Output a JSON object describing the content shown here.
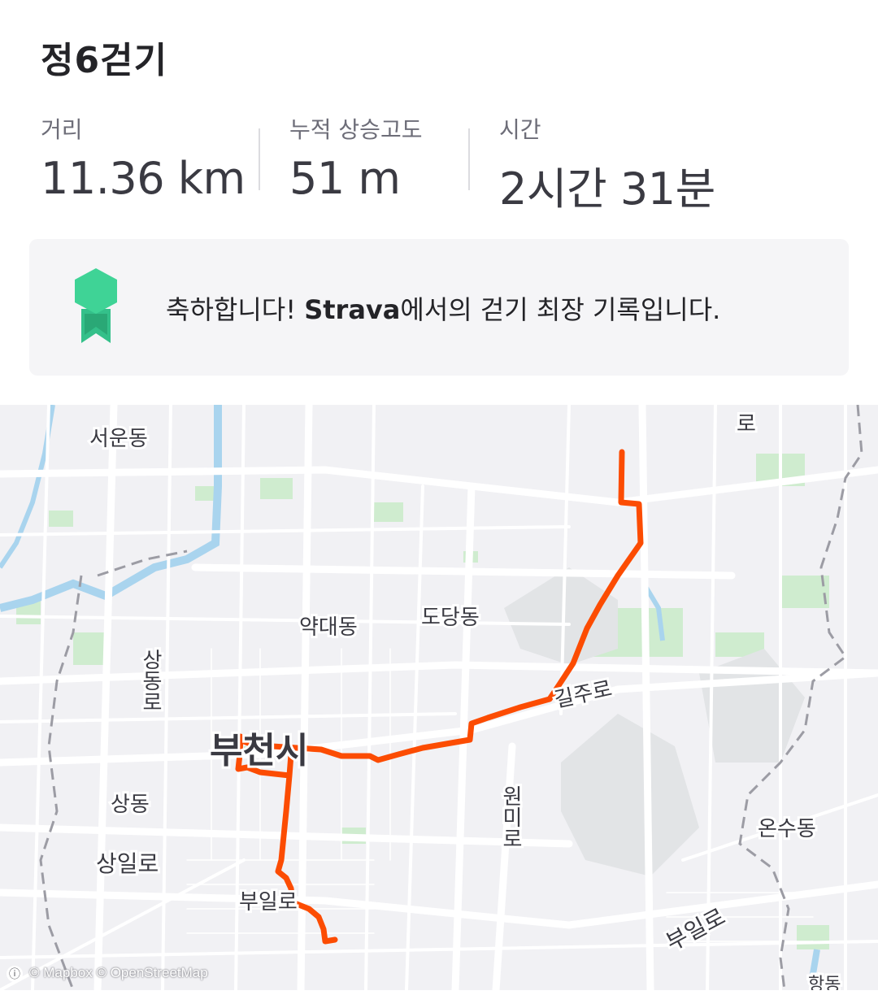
{
  "activity": {
    "title": "정6걷기"
  },
  "stats": [
    {
      "label": "거리",
      "value": "11.36 km"
    },
    {
      "label": "누적 상승고도",
      "value": "51 m"
    },
    {
      "label": "시간",
      "value": "2시간 31분"
    }
  ],
  "banner": {
    "icon": "medal-icon",
    "text_before": "축하합니다! ",
    "brand": "Strava",
    "text_after": "에서의 걷기 최장 기록입니다.",
    "accent_color": "#34c08a"
  },
  "map": {
    "route_color": "#fc4c02",
    "labels": {
      "seoun_dong": "서운동",
      "yakdae_dong": "약대동",
      "dodang_dong": "도당동",
      "sangdong_ro": "상동로",
      "bucheon_si": "부천시",
      "sang_dong": "상동",
      "sangil_ro": "상일로",
      "buil_ro_left": "부일로",
      "gilju_ro": "길주로",
      "wonmi_ro": "원미로",
      "onsu_dong": "온수동",
      "buil_ro_right": "부일로",
      "ro_top": "로",
      "hang_dong": "항동"
    },
    "attribution": "© Mapbox © OpenStreetMap",
    "info_icon": "info-icon"
  }
}
